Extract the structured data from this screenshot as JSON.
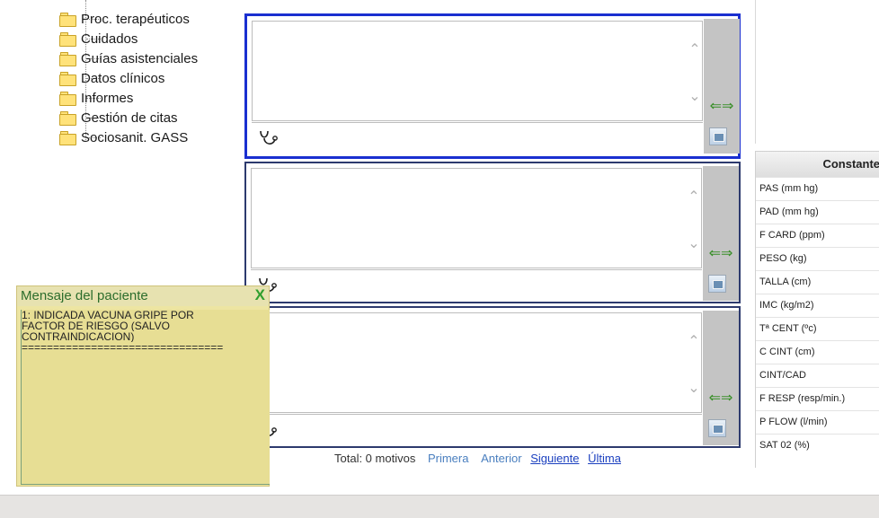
{
  "tree": {
    "items": [
      {
        "label": "Proc. terapéuticos"
      },
      {
        "label": "Cuidados"
      },
      {
        "label": "Guías asistenciales"
      },
      {
        "label": "Datos clínicos"
      },
      {
        "label": "Informes"
      },
      {
        "label": "Gestión de citas"
      },
      {
        "label": "Sociosanit. GASS"
      }
    ]
  },
  "panels": {
    "scroll_up_glyph": "⌃",
    "scroll_down_glyph": "⌄",
    "resize_arrows": "⇐⇒",
    "stethoscope_icon": "stethoscope-icon",
    "image_button_icon": "image-icon"
  },
  "constants": {
    "header": "Constante",
    "rows": [
      "PAS (mm hg)",
      "PAD (mm hg)",
      "F CARD (ppm)",
      "PESO (kg)",
      "TALLA (cm)",
      "IMC (kg/m2)",
      "Tª CENT (ºc)",
      "C CINT (cm)",
      "CINT/CAD",
      "F RESP (resp/min.)",
      "P FLOW (l/min)",
      "SAT 02 (%)"
    ]
  },
  "patient_message": {
    "title": "Mensaje del paciente",
    "close": "X",
    "lines": [
      "1: INDICADA VACUNA GRIPE POR",
      "FACTOR DE RIESGO (SALVO",
      "CONTRAINDICACION)",
      "================================"
    ]
  },
  "footer": {
    "total": "Total: 0 motivos",
    "first": "Primera",
    "previous": "Anterior",
    "next": "Siguiente",
    "last": "Última"
  },
  "colors": {
    "panel_active_border": "#1a2fd0",
    "panel_border": "#2d3a6e",
    "message_bg": "#ede5a2",
    "message_title": "#2c6d2c",
    "link": "#4a7fbf"
  }
}
